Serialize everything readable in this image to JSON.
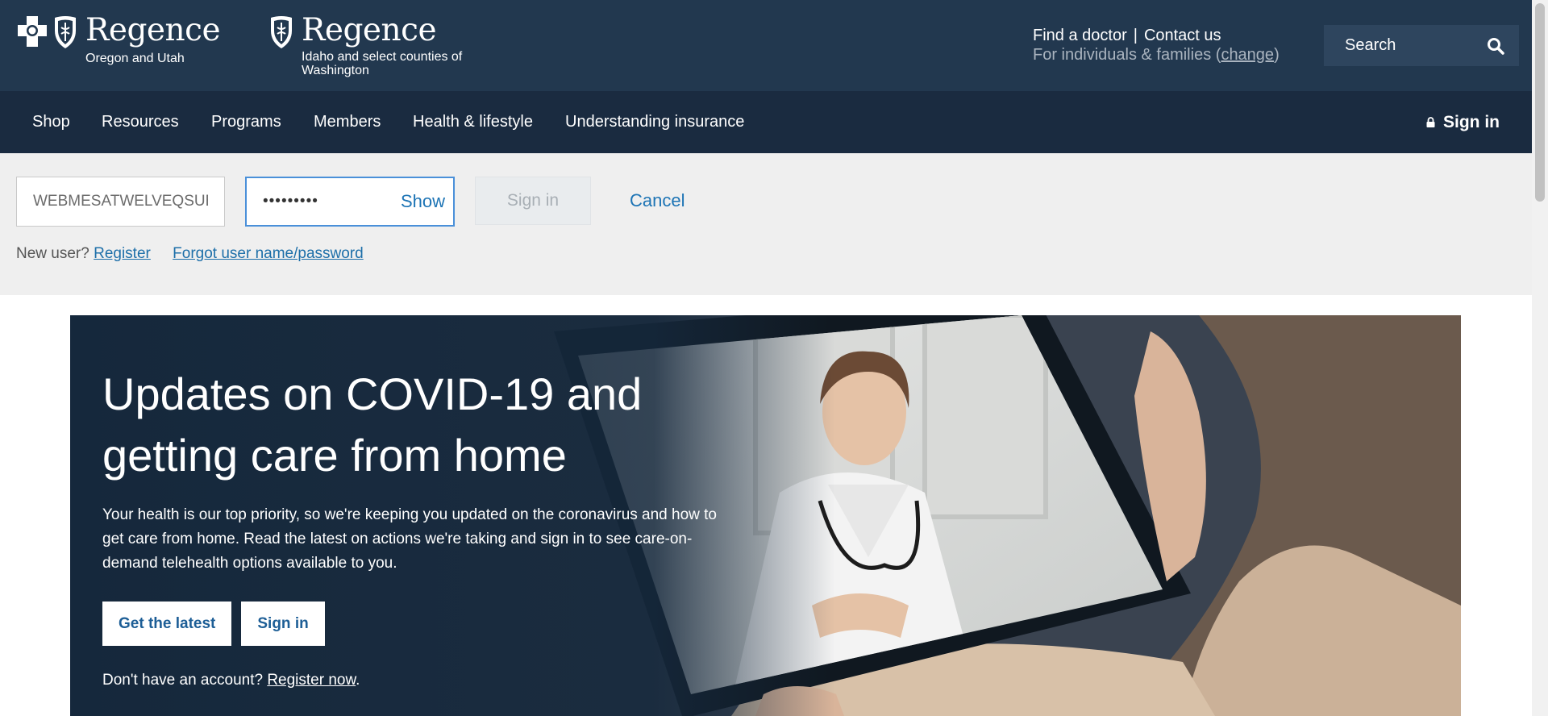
{
  "header": {
    "brands": [
      {
        "name": "Regence",
        "region": "Oregon and Utah"
      },
      {
        "name": "Regence",
        "region": "Idaho and select counties of Washington"
      }
    ],
    "util_links": {
      "find_doctor": "Find a doctor",
      "separator": "|",
      "contact": "Contact us"
    },
    "audience": {
      "text": "For individuals & families",
      "open_paren": "(",
      "change": "change",
      "close_paren": ")"
    },
    "search": {
      "placeholder": "Search",
      "icon": "search-icon"
    }
  },
  "nav": {
    "items": [
      "Shop",
      "Resources",
      "Programs",
      "Members",
      "Health & lifestyle",
      "Understanding insurance"
    ],
    "sign_in": "Sign in",
    "sign_in_icon": "lock-icon"
  },
  "login": {
    "username_value": "WEBMESATWELVEQSUB:",
    "password_value": "•••••••••",
    "show_label": "Show",
    "sign_in_label": "Sign in",
    "cancel_label": "Cancel",
    "new_user_text": "New user?",
    "register_label": "Register",
    "forgot_label": "Forgot user name/password"
  },
  "hero": {
    "title": "Updates on COVID-19 and getting care from home",
    "body": "Your health is our top priority, so we're keeping you updated on the coronavirus and how to get care from home. Read the latest on actions we're taking and sign in to see care-on-demand telehealth options available to you.",
    "buttons": [
      "Get the latest",
      "Sign in"
    ],
    "footer_text": "Don't have an account?",
    "footer_link": "Register now",
    "footer_period": "."
  },
  "colors": {
    "header_bg": "#22384f",
    "nav_bg": "#1a2b40",
    "login_bg": "#efefef",
    "link_blue": "#1d74b5",
    "focus_border": "#4a90d9"
  }
}
